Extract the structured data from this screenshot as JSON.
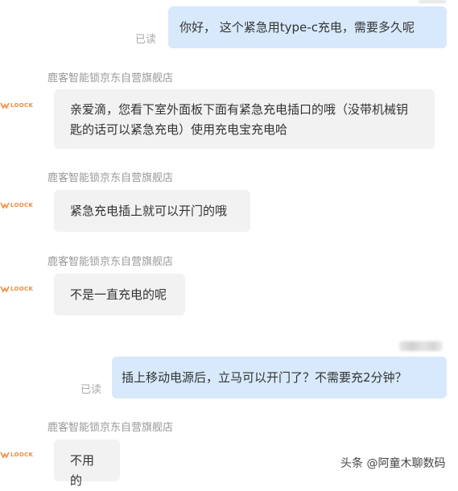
{
  "messages": [
    {
      "text": "你好， 这个紧急用type-c充电，需要多久呢",
      "status": "已读"
    },
    {
      "sender": "鹿客智能锁京东自营旗舰店",
      "text": "亲爱滴，您看下室外面板下面有紧急充电插口的哦（没带机械钥匙的话可以紧急充电）使用充电宝充电哈"
    },
    {
      "sender": "鹿客智能锁京东自营旗舰店",
      "text": "紧急充电插上就可以开门的哦"
    },
    {
      "sender": "鹿客智能锁京东自营旗舰店",
      "text": "不是一直充电的呢"
    },
    {
      "text": "插上移动电源后，立马可以开门了？不需要充2分钟？",
      "status": "已读"
    },
    {
      "sender": "鹿客智能锁京东自营旗舰店",
      "text": "不用的"
    }
  ],
  "logo_text": "LOOCK",
  "watermark": "头条 @阿童木聊数码",
  "colors": {
    "outgoing": "#d7e9fb",
    "incoming": "#f2f2f2",
    "logo": "#f28a3a"
  }
}
